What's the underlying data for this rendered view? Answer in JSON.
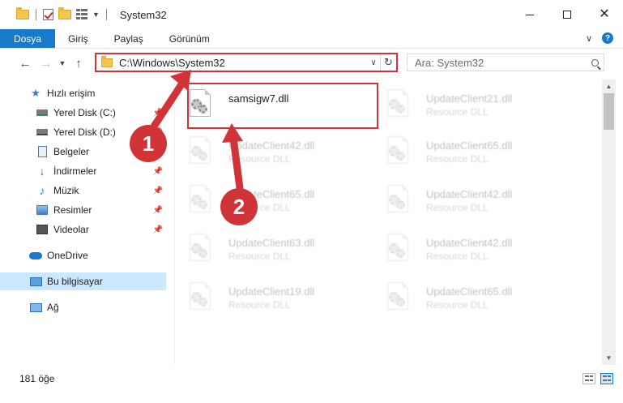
{
  "window": {
    "title": "System32",
    "controls": {
      "minimize": "minimize",
      "maximize": "maximize",
      "close": "✕"
    }
  },
  "ribbon": {
    "tabs": [
      "Dosya",
      "Giriş",
      "Paylaş",
      "Görünüm"
    ],
    "help": "?"
  },
  "address_bar": {
    "path": "C:\\Windows\\System32",
    "search_placeholder": "Ara: System32"
  },
  "nav_pane": {
    "items": [
      {
        "label": "Hızlı erişim",
        "icon": "star-icon",
        "pinned": false
      },
      {
        "label": "Yerel Disk (C:)",
        "icon": "drive-c-icon",
        "pinned": true
      },
      {
        "label": "Yerel Disk (D:)",
        "icon": "drive-d-icon",
        "pinned": true
      },
      {
        "label": "Belgeler",
        "icon": "documents-icon",
        "pinned": true
      },
      {
        "label": "İndirmeler",
        "icon": "downloads-icon",
        "pinned": true
      },
      {
        "label": "Müzik",
        "icon": "music-icon",
        "pinned": true
      },
      {
        "label": "Resimler",
        "icon": "pictures-icon",
        "pinned": true
      },
      {
        "label": "Videolar",
        "icon": "videos-icon",
        "pinned": true
      },
      {
        "label": "OneDrive",
        "icon": "onedrive-icon",
        "pinned": false
      },
      {
        "label": "Bu bilgisayar",
        "icon": "this-pc-icon",
        "pinned": false,
        "selected": true
      },
      {
        "label": "Ağ",
        "icon": "network-icon",
        "pinned": false
      }
    ]
  },
  "files": [
    {
      "name": "samsigw7.dll",
      "type": "",
      "highlighted": true
    },
    {
      "name": "UpdateClient21.dll",
      "type": "Resource DLL"
    },
    {
      "name": "UpdateClient42.dll",
      "type": "Resource DLL"
    },
    {
      "name": "UpdateClient65.dll",
      "type": "Resource DLL"
    },
    {
      "name": "UpdateClient65.dll",
      "type": "Resource DLL"
    },
    {
      "name": "UpdateClient42.dll",
      "type": "Resource DLL"
    },
    {
      "name": "UpdateClient63.dll",
      "type": "Resource DLL"
    },
    {
      "name": "UpdateClient42.dll",
      "type": "Resource DLL"
    },
    {
      "name": "UpdateClient19.dll",
      "type": "Resource DLL"
    },
    {
      "name": "UpdateClient65.dll",
      "type": "Resource DLL"
    }
  ],
  "status": {
    "item_count": "181 öğe"
  },
  "annotations": {
    "step1": "1",
    "step2": "2"
  },
  "colors": {
    "accent": "#1979ca",
    "annotation": "#d13438",
    "selection": "#cce8ff"
  }
}
